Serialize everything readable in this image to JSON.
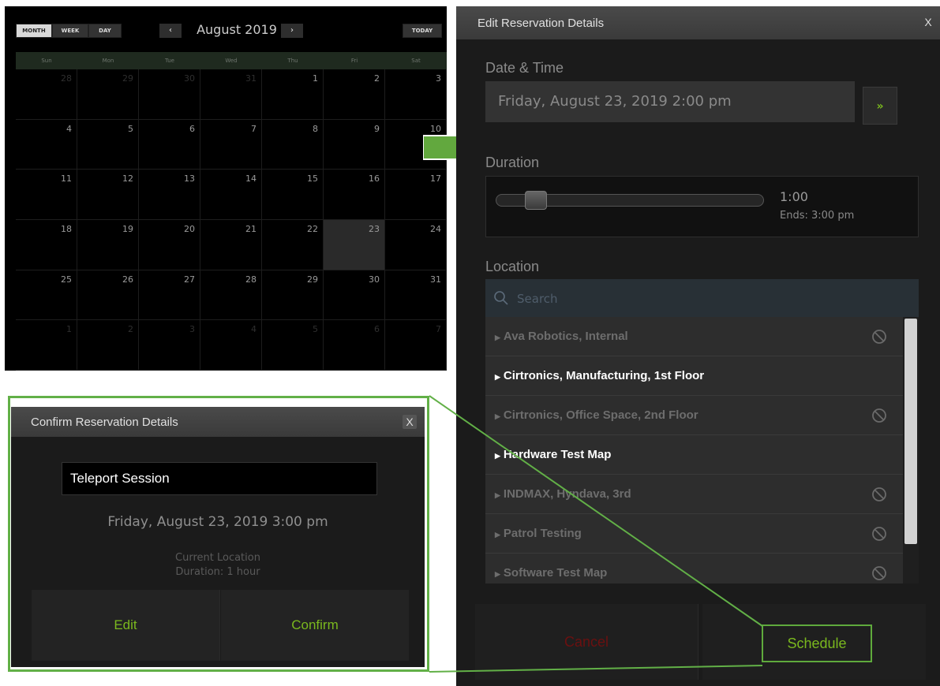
{
  "calendar": {
    "view_buttons": [
      "MONTH",
      "WEEK",
      "DAY"
    ],
    "prev_label": "‹",
    "next_label": "›",
    "title": "August 2019",
    "today_label": "TODAY",
    "weekdays": [
      "Sun",
      "Mon",
      "Tue",
      "Wed",
      "Thu",
      "Fri",
      "Sat"
    ],
    "days": [
      {
        "n": "28",
        "other": true
      },
      {
        "n": "29",
        "other": true
      },
      {
        "n": "30",
        "other": true
      },
      {
        "n": "31",
        "other": true
      },
      {
        "n": "1"
      },
      {
        "n": "2"
      },
      {
        "n": "3"
      },
      {
        "n": "4"
      },
      {
        "n": "5"
      },
      {
        "n": "6"
      },
      {
        "n": "7"
      },
      {
        "n": "8"
      },
      {
        "n": "9"
      },
      {
        "n": "10"
      },
      {
        "n": "11"
      },
      {
        "n": "12"
      },
      {
        "n": "13"
      },
      {
        "n": "14"
      },
      {
        "n": "15"
      },
      {
        "n": "16"
      },
      {
        "n": "17"
      },
      {
        "n": "18"
      },
      {
        "n": "19"
      },
      {
        "n": "20"
      },
      {
        "n": "21"
      },
      {
        "n": "22"
      },
      {
        "n": "23",
        "selected": true
      },
      {
        "n": "24"
      },
      {
        "n": "25"
      },
      {
        "n": "26"
      },
      {
        "n": "27"
      },
      {
        "n": "28"
      },
      {
        "n": "29"
      },
      {
        "n": "30"
      },
      {
        "n": "31"
      },
      {
        "n": "1",
        "other": true
      },
      {
        "n": "2",
        "other": true
      },
      {
        "n": "3",
        "other": true
      },
      {
        "n": "4",
        "other": true
      },
      {
        "n": "5",
        "other": true
      },
      {
        "n": "6",
        "other": true
      },
      {
        "n": "7",
        "other": true
      }
    ]
  },
  "edit_panel": {
    "title": "Edit Reservation Details",
    "close_label": "X",
    "date_time_label": "Date & Time",
    "date_time_value": "Friday, August 23, 2019 2:00 pm",
    "next_label": "»",
    "duration_label": "Duration",
    "duration_value": "1:00",
    "duration_ends": "Ends: 3:00 pm",
    "duration_slider_fraction": 0.12,
    "location_label": "Location",
    "search_placeholder": "Search",
    "locations": [
      {
        "name": "Ava Robotics, Internal",
        "disabled": true
      },
      {
        "name": "Cirtronics, Manufacturing, 1st Floor",
        "disabled": false
      },
      {
        "name": "Cirtronics, Office Space, 2nd Floor",
        "disabled": true
      },
      {
        "name": "Hardware Test Map",
        "disabled": false
      },
      {
        "name": "INDMAX, Hyndava, 3rd",
        "disabled": true
      },
      {
        "name": "Patrol Testing",
        "disabled": true
      },
      {
        "name": "Software Test Map",
        "disabled": true
      }
    ],
    "cancel_label": "Cancel",
    "schedule_label": "Schedule"
  },
  "confirm_panel": {
    "title": "Confirm Reservation Details",
    "close_label": "X",
    "session_name": "Teleport Session",
    "date_time": "Friday, August 23, 2019 3:00 pm",
    "location": "Current Location",
    "duration": "Duration: 1 hour",
    "edit_label": "Edit",
    "confirm_label": "Confirm"
  },
  "colors": {
    "accent_green": "#7ab81e",
    "highlight_green": "#62b047",
    "cancel_red": "#6b1010",
    "panel_bg": "#1b1b1b"
  }
}
